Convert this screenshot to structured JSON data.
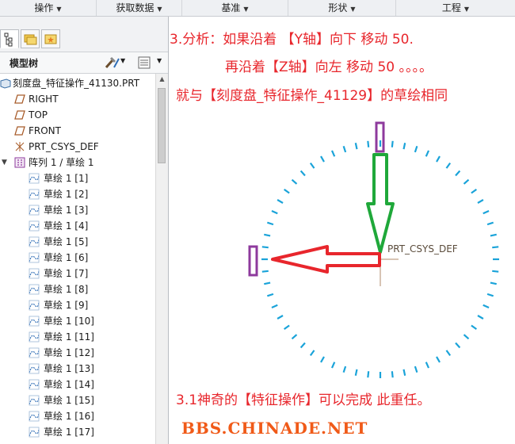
{
  "menubar": {
    "items": [
      {
        "label": "操作"
      },
      {
        "label": "获取数据"
      },
      {
        "label": "基准"
      },
      {
        "label": "形状"
      },
      {
        "label": "工程"
      }
    ]
  },
  "panel": {
    "title": "模型树",
    "root": "刻度盘_特征操作_41130.PRT",
    "datums": [
      "RIGHT",
      "TOP",
      "FRONT"
    ],
    "csys": "PRT_CSYS_DEF",
    "pattern": "阵列 1 / 草绘 1",
    "sketches": [
      "草绘 1 [1]",
      "草绘 1 [2]",
      "草绘 1 [3]",
      "草绘 1 [4]",
      "草绘 1 [5]",
      "草绘 1 [6]",
      "草绘 1 [7]",
      "草绘 1 [8]",
      "草绘 1 [9]",
      "草绘 1 [10]",
      "草绘 1 [11]",
      "草绘 1 [12]",
      "草绘 1 [13]",
      "草绘 1 [14]",
      "草绘 1 [15]",
      "草绘 1 [16]",
      "草绘 1 [17]"
    ]
  },
  "canvas": {
    "notes": {
      "line1": "3.分析：如果沿着 【Y轴】向下 移动 50.",
      "line2": "再沿着【Z轴】向左 移动 50 。。。。",
      "line3": "就与【刻度盘_特征操作_41129】的草绘相同",
      "bottom": "3.1神奇的【特征操作】可以完成 此重任。"
    },
    "csys_label": "PRT_CSYS_DEF",
    "watermark": "BBS.CHINADE.NET",
    "tick_count": 60
  },
  "colors": {
    "annotation_red": "#e8262c",
    "tick_blue": "#1aa3d9",
    "arrow_green": "#1fa83a",
    "marker_purple": "#8e3a9d",
    "watermark_orange": "#f05a18"
  }
}
